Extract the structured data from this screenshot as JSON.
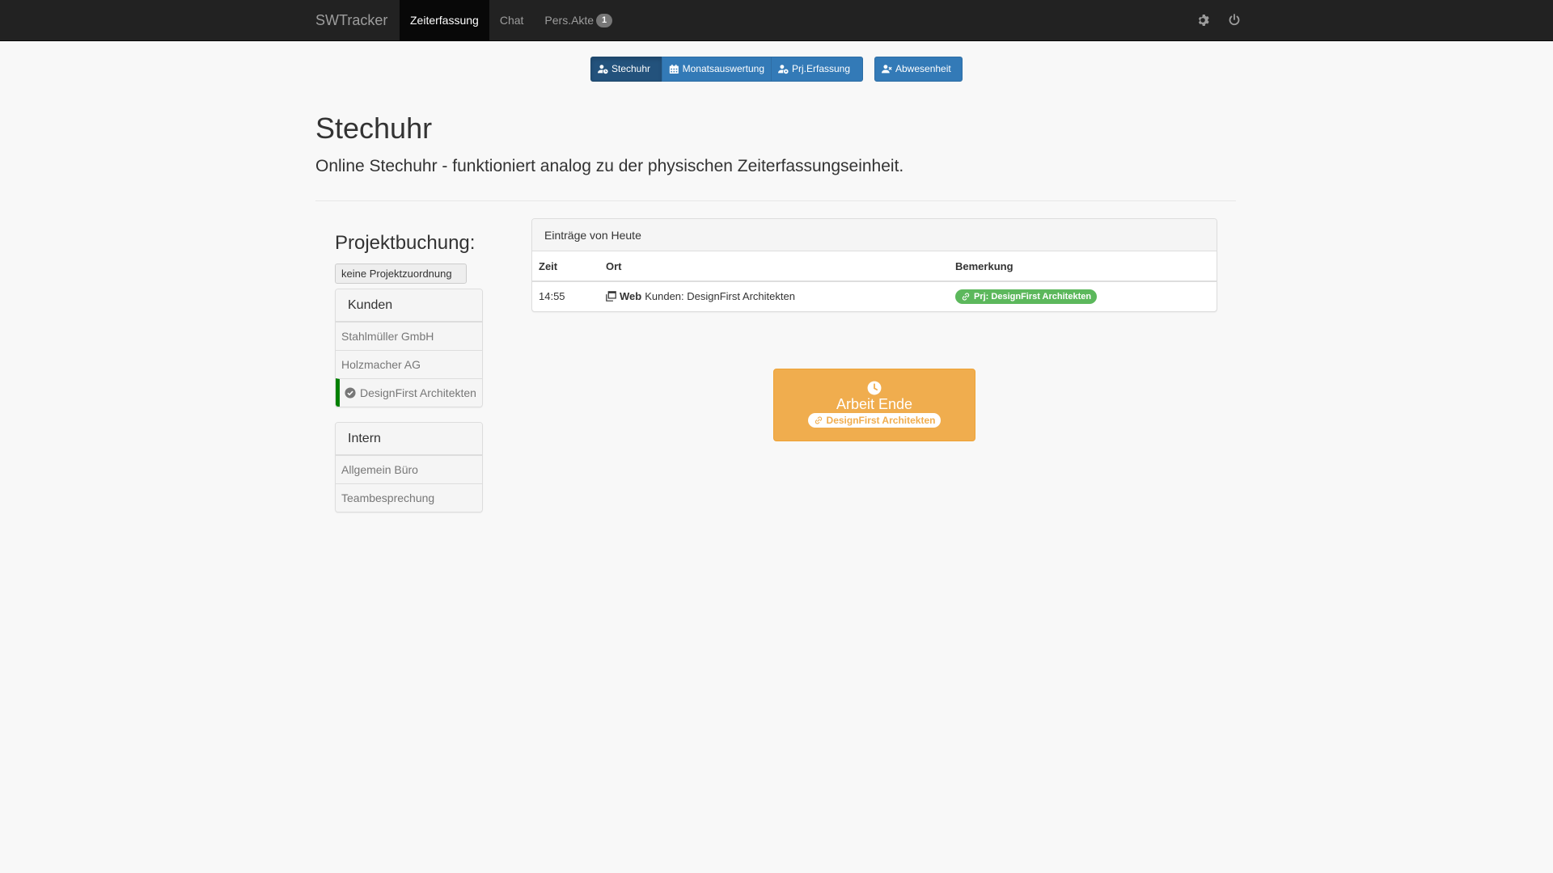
{
  "navbar": {
    "brand": "SWTracker",
    "items": [
      {
        "label": "Zeiterfassung",
        "active": true
      },
      {
        "label": "Chat",
        "active": false
      },
      {
        "label": "Pers.Akte",
        "active": false,
        "badge": "1"
      }
    ],
    "right_icons": [
      "gear-icon",
      "power-icon"
    ]
  },
  "toolbar": {
    "buttons": [
      {
        "label": "Stechuhr",
        "icon": "user-clock-icon",
        "active": true
      },
      {
        "label": "Monatsauswertung",
        "icon": "calendar-icon",
        "active": false
      },
      {
        "label": "Prj.Erfassung",
        "icon": "user-gear-icon",
        "active": false
      },
      {
        "label": "Abwesenheit",
        "icon": "user-times-icon",
        "active": false
      }
    ]
  },
  "header": {
    "title": "Stechuhr",
    "lead": "Online Stechuhr - funktioniert analog zu der physischen Zeiterfassungseinheit."
  },
  "projektbuchung": {
    "title": "Projektbuchung:",
    "button_label": "keine Projektzuordnung",
    "groups": [
      {
        "heading": "Kunden",
        "items": [
          {
            "label": "Stahlmüller GmbH",
            "selected": false
          },
          {
            "label": "Holzmacher AG",
            "selected": false
          },
          {
            "label": "DesignFirst Architekten",
            "selected": true
          }
        ]
      },
      {
        "heading": "Intern",
        "items": [
          {
            "label": "Allgemein Büro",
            "selected": false
          },
          {
            "label": "Teambesprechung",
            "selected": false
          }
        ]
      }
    ]
  },
  "entries": {
    "heading": "Einträge von Heute",
    "columns": [
      "Zeit",
      "Ort",
      "Bemerkung"
    ],
    "rows": [
      {
        "zeit": "14:55",
        "ort_strong": "Web",
        "ort_text": "Kunden: DesignFirst Architekten",
        "bemerkung": "Prj: DesignFirst Architekten"
      }
    ]
  },
  "action_button": {
    "label": "Arbeit Ende",
    "project": "DesignFirst Architekten"
  },
  "colors": {
    "navbar": "#222222",
    "primary": "#337ab7",
    "success": "#5cb85c",
    "warning": "#f0ad4e",
    "selected_marker": "#008000"
  }
}
